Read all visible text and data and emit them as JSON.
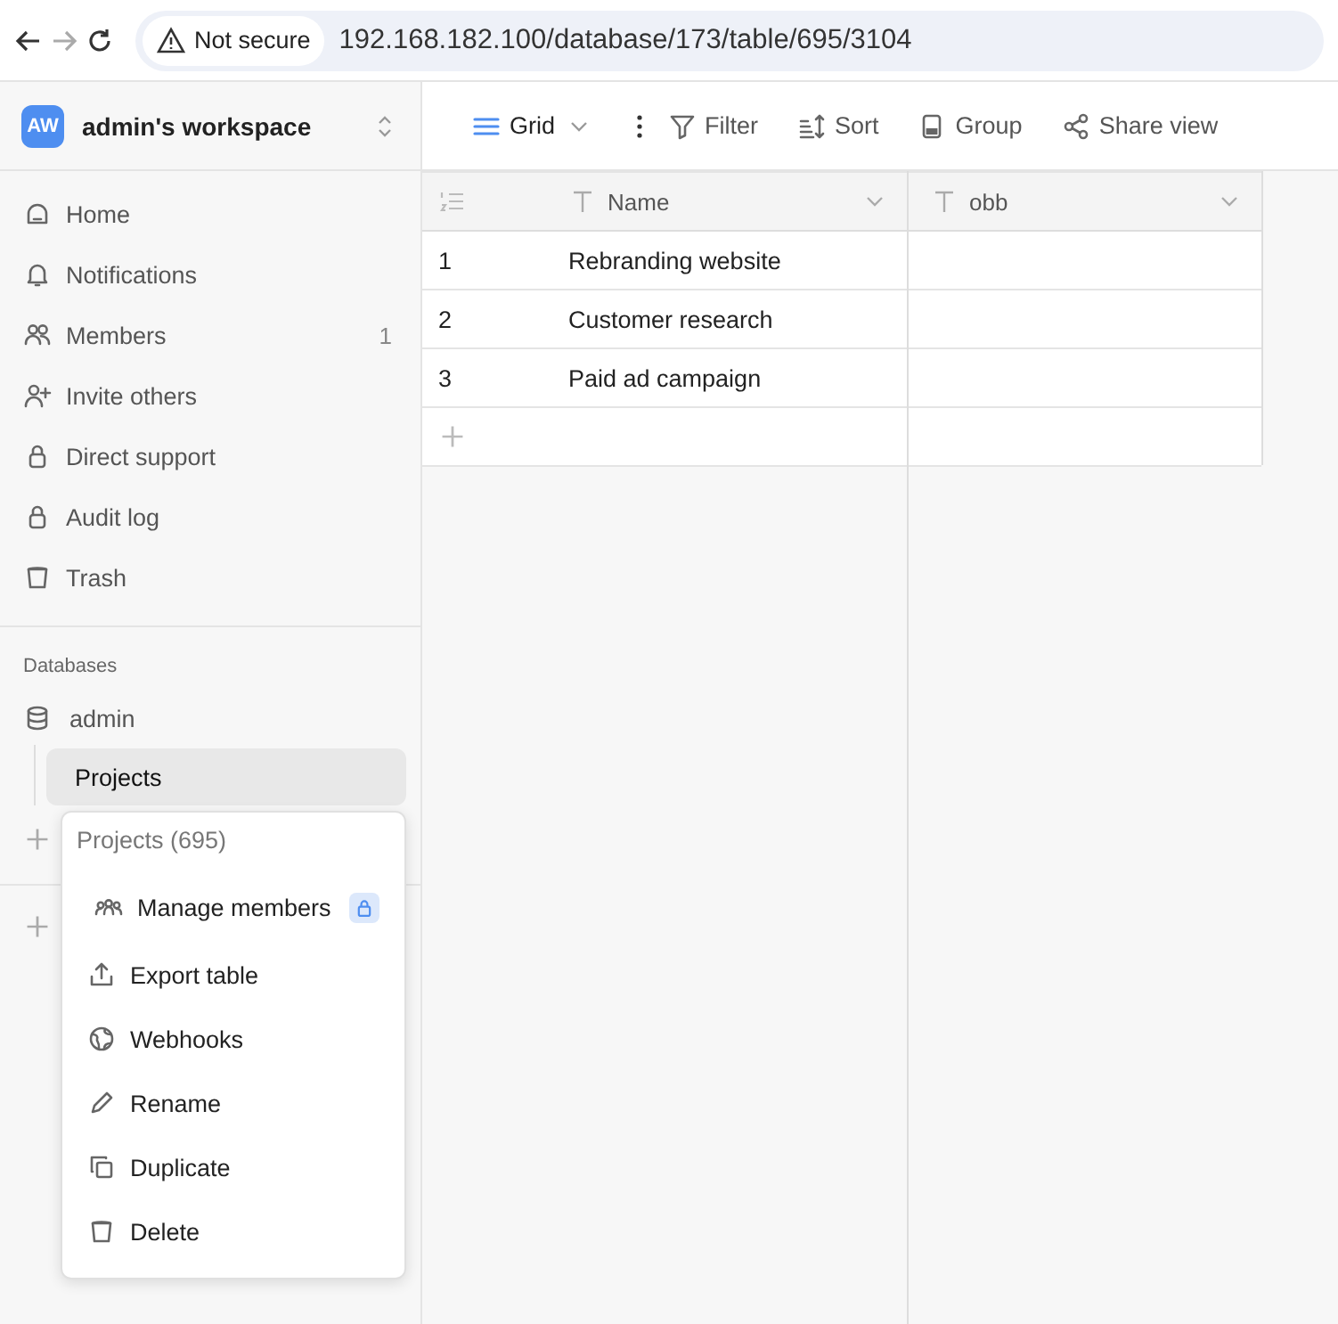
{
  "browser": {
    "security": "Not secure",
    "url": "192.168.182.100/database/173/table/695/3104"
  },
  "workspace": {
    "initials": "AW",
    "name": "admin's workspace"
  },
  "sidebar": {
    "items": [
      {
        "label": "Home"
      },
      {
        "label": "Notifications"
      },
      {
        "label": "Members",
        "count": "1"
      },
      {
        "label": "Invite others"
      },
      {
        "label": "Direct support"
      },
      {
        "label": "Audit log"
      },
      {
        "label": "Trash"
      }
    ],
    "section": "Databases",
    "databases": [
      {
        "label": "admin",
        "children": [
          {
            "label": "Projects",
            "selected": true
          }
        ]
      }
    ]
  },
  "toolbar": [
    {
      "label": "Grid"
    },
    {
      "label": "Filter"
    },
    {
      "label": "Sort"
    },
    {
      "label": "Group"
    },
    {
      "label": "Share view"
    }
  ],
  "table": {
    "columns": [
      "Name",
      "obb"
    ],
    "rows": [
      {
        "id": "1",
        "cells": [
          "Rebranding website",
          ""
        ]
      },
      {
        "id": "2",
        "cells": [
          "Customer research",
          ""
        ]
      },
      {
        "id": "3",
        "cells": [
          "Paid ad campaign",
          ""
        ]
      }
    ]
  },
  "context_menu": {
    "title": "Projects (695)",
    "items": [
      {
        "label": "Manage members",
        "locked": true
      },
      {
        "label": "Export table",
        "locked": false
      },
      {
        "label": "Webhooks",
        "locked": false
      },
      {
        "label": "Rename",
        "locked": false
      },
      {
        "label": "Duplicate",
        "locked": false
      },
      {
        "label": "Delete",
        "locked": false
      }
    ]
  }
}
